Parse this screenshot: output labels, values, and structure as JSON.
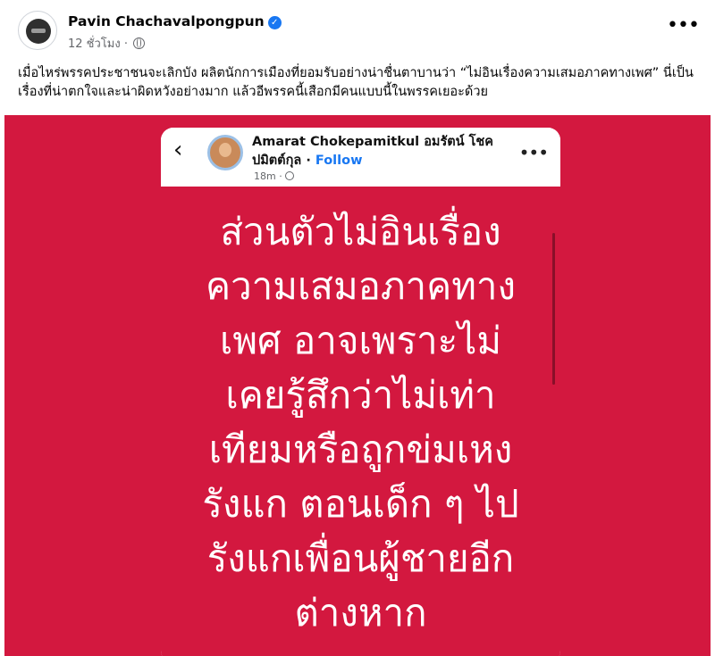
{
  "post": {
    "author": "Pavin Chachavalpongpun",
    "verified_icon": "verified-badge-icon",
    "time": "12 ชั่วโมง",
    "dot": "·",
    "more": "•••",
    "text": "เมื่อไหร่พรรคประชาชนจะเลิกบัง ผลิตนักการเมืองที่ยอมรับอย่างน่าชื่นตาบานว่า “ไม่อินเรื่องความเสมอภาคทางเพศ” นี่เป็นเรื่องที่น่าตกใจและน่าผิดหวังอย่างมาก แล้วอีพรรคนี้เสือกมีคนแบบนี้ในพรรคเยอะด้วย"
  },
  "screenshot": {
    "back": "‹",
    "name": "Amarat Chokepamitkul อมรัตน์ โชคปมิตต์กุล",
    "dot": "·",
    "follow": "Follow",
    "time": "18m",
    "more": "•••",
    "lines": [
      "ส่วนตัวไม่อินเรื่อง",
      "ความเสมอภาคทาง",
      "เพศ อาจเพราะไม่",
      "เคยรู้สึกว่าไม่เท่า",
      "เทียมหรือถูกข่มเหง",
      "รังแก ตอนเด็ก ๆ ไป",
      "รังแกเพื่อนผู้ชายอีก",
      "ต่างหาก"
    ]
  },
  "colors": {
    "background_red": "#d3183f",
    "facebook_blue": "#1877f2",
    "muted_text": "#65676b"
  }
}
